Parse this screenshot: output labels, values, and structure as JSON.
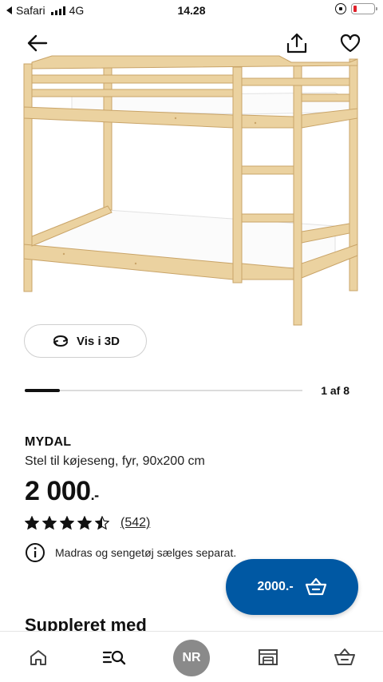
{
  "status_bar": {
    "carrier": "Safari",
    "network": "4G",
    "time": "14.28"
  },
  "toolbar": {
    "back_icon": "arrow-left-icon",
    "share_icon": "share-icon",
    "favorite_icon": "heart-icon"
  },
  "gallery": {
    "view_3d_label": "Vis i 3D",
    "page_indicator": "1 af 8",
    "progress_fraction": 0.125
  },
  "product": {
    "name": "MYDAL",
    "description": "Stel til køjeseng, fyr, 90x200 cm",
    "price": "2 000",
    "price_suffix": ".-",
    "rating": 4.5,
    "review_count": "(542)",
    "info_text": "Madras og sengetøj sælges separat."
  },
  "cart_button": {
    "label": "2000.-",
    "icon": "basket-icon"
  },
  "section": {
    "title": "Suppleret med"
  },
  "bottom_nav": {
    "items": [
      "home-icon",
      "search-list-icon",
      "profile-avatar",
      "store-icon",
      "basket-icon"
    ],
    "avatar_initials": "NR"
  },
  "colors": {
    "brand_blue": "#0058a3",
    "battery_low": "#e0202a",
    "wood": "#e8c98f"
  }
}
